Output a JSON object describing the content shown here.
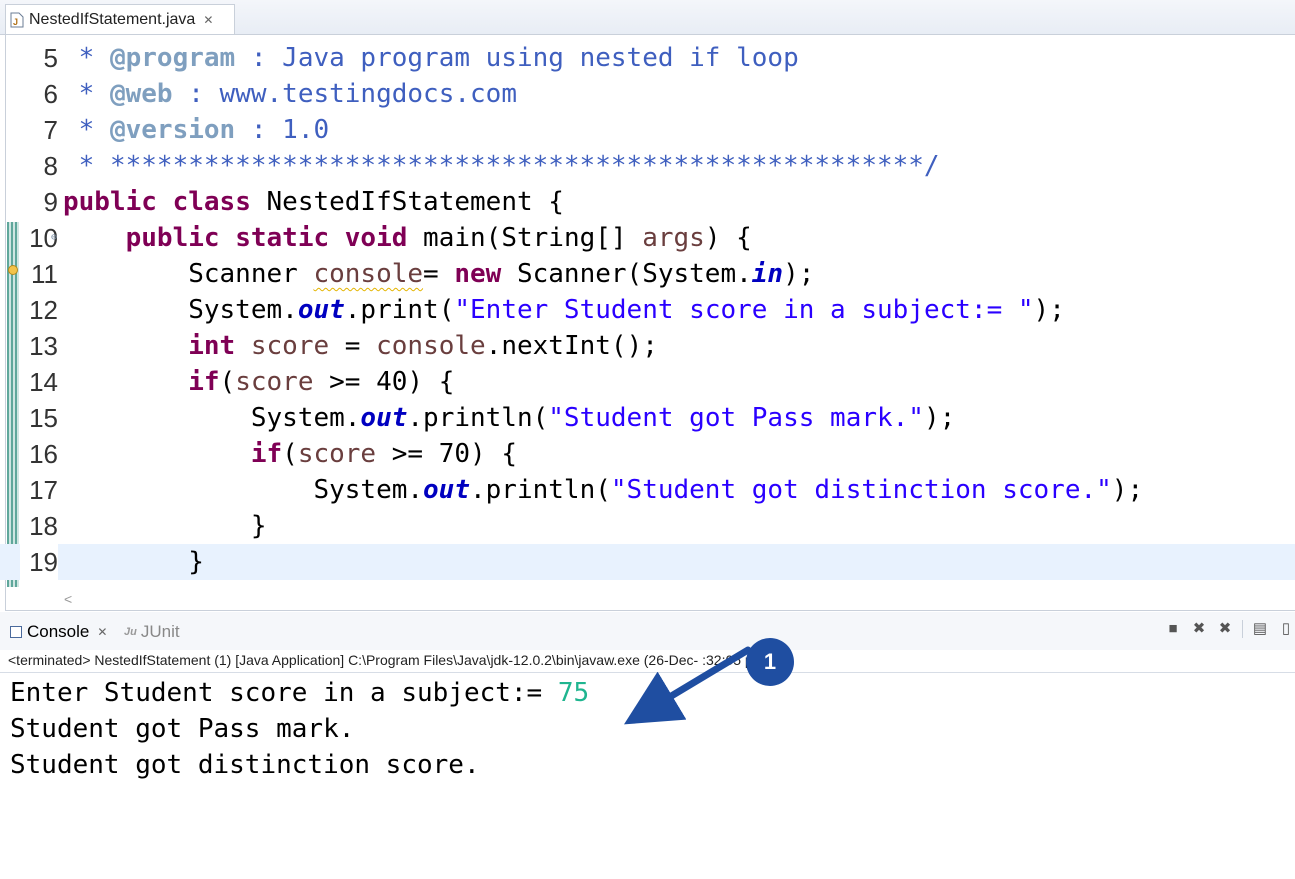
{
  "editor": {
    "tab": {
      "filename": "NestedIfStatement.java",
      "close_glyph": "✕"
    },
    "lines": [
      {
        "num": "5",
        "tokens": [
          {
            "t": " * ",
            "c": "c-doc"
          },
          {
            "t": "@program",
            "c": "c-tag"
          },
          {
            "t": " : Java program using nested if loop",
            "c": "c-doc"
          }
        ]
      },
      {
        "num": "6",
        "tokens": [
          {
            "t": " * ",
            "c": "c-doc"
          },
          {
            "t": "@web",
            "c": "c-tag"
          },
          {
            "t": " : www.testingdocs.com",
            "c": "c-doc"
          }
        ]
      },
      {
        "num": "7",
        "tokens": [
          {
            "t": " * ",
            "c": "c-doc"
          },
          {
            "t": "@version",
            "c": "c-tag"
          },
          {
            "t": " : 1.0",
            "c": "c-doc"
          }
        ]
      },
      {
        "num": "8",
        "tokens": [
          {
            "t": " * ****************************************************/",
            "c": "c-doc"
          }
        ]
      },
      {
        "num": "9",
        "tokens": [
          {
            "t": "public",
            "c": "kw"
          },
          {
            "t": " ",
            "c": "plain"
          },
          {
            "t": "class",
            "c": "kw"
          },
          {
            "t": " NestedIfStatement {",
            "c": "plain"
          }
        ]
      },
      {
        "num": "10",
        "fold": true,
        "tokens": [
          {
            "t": "    ",
            "c": "plain"
          },
          {
            "t": "public",
            "c": "kw"
          },
          {
            "t": " ",
            "c": "plain"
          },
          {
            "t": "static",
            "c": "kw"
          },
          {
            "t": " ",
            "c": "plain"
          },
          {
            "t": "void",
            "c": "kw"
          },
          {
            "t": " main(String[] ",
            "c": "plain"
          },
          {
            "t": "args",
            "c": "var"
          },
          {
            "t": ") {",
            "c": "plain"
          }
        ]
      },
      {
        "num": "11",
        "tokens": [
          {
            "t": "        Scanner ",
            "c": "plain"
          },
          {
            "t": "console",
            "c": "var squiggle"
          },
          {
            "t": "= ",
            "c": "plain"
          },
          {
            "t": "new",
            "c": "kw"
          },
          {
            "t": " Scanner(System.",
            "c": "plain"
          },
          {
            "t": "in",
            "c": "fld"
          },
          {
            "t": ");",
            "c": "plain"
          }
        ]
      },
      {
        "num": "12",
        "tokens": [
          {
            "t": "        System.",
            "c": "plain"
          },
          {
            "t": "out",
            "c": "fld"
          },
          {
            "t": ".print(",
            "c": "plain"
          },
          {
            "t": "\"Enter Student score in a subject:= \"",
            "c": "str"
          },
          {
            "t": ");",
            "c": "plain"
          }
        ]
      },
      {
        "num": "13",
        "tokens": [
          {
            "t": "        ",
            "c": "plain"
          },
          {
            "t": "int",
            "c": "kw"
          },
          {
            "t": " ",
            "c": "plain"
          },
          {
            "t": "score",
            "c": "var"
          },
          {
            "t": " = ",
            "c": "plain"
          },
          {
            "t": "console",
            "c": "var"
          },
          {
            "t": ".nextInt();",
            "c": "plain"
          }
        ]
      },
      {
        "num": "14",
        "tokens": [
          {
            "t": "        ",
            "c": "plain"
          },
          {
            "t": "if",
            "c": "kw"
          },
          {
            "t": "(",
            "c": "plain"
          },
          {
            "t": "score",
            "c": "var"
          },
          {
            "t": " >= 40) {",
            "c": "plain"
          }
        ]
      },
      {
        "num": "15",
        "tokens": [
          {
            "t": "            System.",
            "c": "plain"
          },
          {
            "t": "out",
            "c": "fld"
          },
          {
            "t": ".println(",
            "c": "plain"
          },
          {
            "t": "\"Student got Pass mark.\"",
            "c": "str"
          },
          {
            "t": ");",
            "c": "plain"
          }
        ]
      },
      {
        "num": "16",
        "tokens": [
          {
            "t": "            ",
            "c": "plain"
          },
          {
            "t": "if",
            "c": "kw"
          },
          {
            "t": "(",
            "c": "plain"
          },
          {
            "t": "score",
            "c": "var"
          },
          {
            "t": " >= 70) {",
            "c": "plain"
          }
        ]
      },
      {
        "num": "17",
        "tokens": [
          {
            "t": "                System.",
            "c": "plain"
          },
          {
            "t": "out",
            "c": "fld"
          },
          {
            "t": ".println(",
            "c": "plain"
          },
          {
            "t": "\"Student got distinction score.\"",
            "c": "str"
          },
          {
            "t": ");",
            "c": "plain"
          }
        ]
      },
      {
        "num": "18",
        "tokens": [
          {
            "t": "            }",
            "c": "plain"
          }
        ]
      },
      {
        "num": "19",
        "current": true,
        "tokens": [
          {
            "t": "        }",
            "c": "plain"
          }
        ]
      }
    ]
  },
  "console": {
    "tabs": [
      {
        "label": "Console",
        "icon": "console-icon",
        "close_glyph": "✕"
      },
      {
        "label": "JUnit",
        "icon": "junit-icon",
        "icon_text": "Ju"
      }
    ],
    "toolbar_icons": [
      "terminate-icon",
      "remove-launch-icon",
      "remove-all-icon",
      "clear-console-icon"
    ],
    "status": "<terminated> NestedIfStatement (1) [Java Application] C:\\Program Files\\Java\\jdk-12.0.2\\bin\\javaw.exe (26-Dec-      :32:05 pm)",
    "output": {
      "prompt": "Enter Student score in a subject:= ",
      "input_value": "75",
      "lines": [
        "Student got Pass mark.",
        "Student got distinction score."
      ]
    }
  },
  "annotation": {
    "badge": "1",
    "color": "#1f4ea1"
  }
}
